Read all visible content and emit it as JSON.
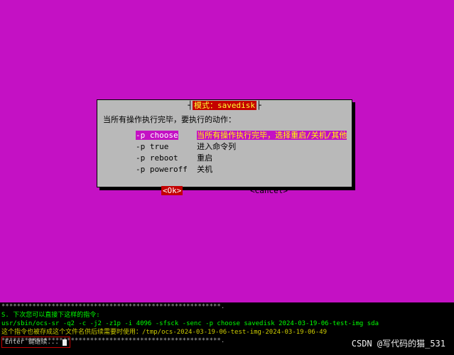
{
  "dialog": {
    "title_left_bracket": "┤",
    "title_text": "模式：savedisk",
    "title_right_bracket": "├",
    "prompt": "当所有操作执行完毕，要执行的动作：",
    "options": [
      {
        "key": "-p choose",
        "desc": "当所有操作执行完毕，选择重启/关机/其他",
        "selected": true
      },
      {
        "key": "-p true",
        "desc": "进入命令列",
        "selected": false
      },
      {
        "key": "-p reboot",
        "desc": "重启",
        "selected": false
      },
      {
        "key": "-p poweroff",
        "desc": "关机",
        "selected": false
      }
    ],
    "ok_label": "<Ok>",
    "cancel_label": "<Cancel>"
  },
  "terminal": {
    "stars1": "*********************************************************.",
    "ps": "S. 下次您可以直接下这样的指令:",
    "cmd": "usr/sbin/ocs-sr -q2 -c -j2 -z1p -i 4096 -sfsck -senc -p choose savedisk 2024-03-19-06-test-img sda",
    "info": "这个指令也被存成这个文件名供后续需要时使用：/tmp/ocs-2024-03-19-06-test-img-2024-03-19-06-49",
    "stars2": "*********************************************************.",
    "enter_prompt": " Enter 键继续... "
  },
  "watermark": "CSDN @写代码的猫_531"
}
